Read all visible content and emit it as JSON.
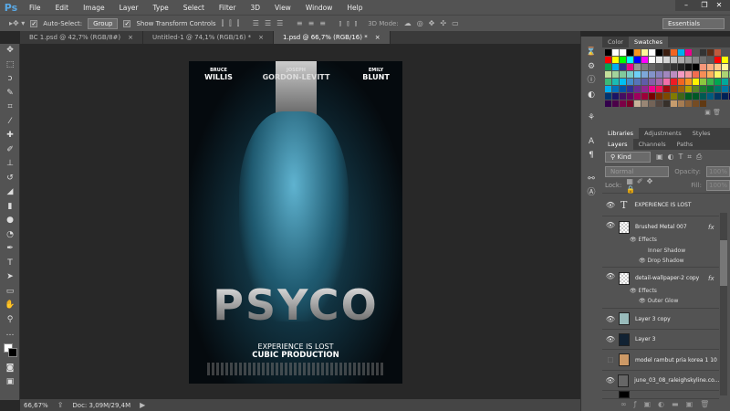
{
  "app": {
    "logo": "Ps"
  },
  "menu": [
    "File",
    "Edit",
    "Image",
    "Layer",
    "Type",
    "Select",
    "Filter",
    "3D",
    "View",
    "Window",
    "Help"
  ],
  "window_controls": {
    "minimize": "–",
    "restore": "❐",
    "close": "✕"
  },
  "options": {
    "auto_select_label": "Auto-Select:",
    "auto_select_value": "Group",
    "show_transform_label": "Show Transform Controls",
    "mode_3d_label": "3D Mode:",
    "workspace": "Essentials"
  },
  "doc_tabs": [
    {
      "label": "BC 1.psd @ 42,7% (RGB/8#)",
      "close": "×"
    },
    {
      "label": "Untitled-1 @ 74,1% (RGB/16) *",
      "close": "×"
    },
    {
      "label": "1.psd @ 66,7% (RGB/16) *",
      "close": "×",
      "active": true
    }
  ],
  "poster": {
    "actor1_first": "BRUCE",
    "actor1_last": "WILLIS",
    "actor2_first": "JOSEPH",
    "actor2_last": "GORDON-LEVITT",
    "actor3_first": "EMILY",
    "actor3_last": "BLUNT",
    "title": "PSYCO",
    "tagline": "EXPERIENCE IS LOST",
    "studio": "CUBIC PRODUCTION"
  },
  "status": {
    "zoom": "66,67%",
    "doc": "Doc: 3,09M/29,4M"
  },
  "color_panel": {
    "tabs": [
      "Color",
      "Swatches"
    ],
    "active": "Swatches"
  },
  "swatch_colors": [
    "#000000",
    "#ffffff",
    "#ffffff",
    "#000000",
    "#f7941d",
    "#fff799",
    "#ffffff",
    "#000000",
    "#3c1e10",
    "#f26522",
    "#00aeef",
    "#ec008c",
    "#555555",
    "#333333",
    "#5b2d17",
    "#c1593c",
    "#535353",
    "#535353",
    "#ff0000",
    "#ffff00",
    "#00ff00",
    "#00ffff",
    "#0000ff",
    "#ff00ff",
    "#ffffff",
    "#ebebeb",
    "#d6d6d6",
    "#c2c2c2",
    "#adadad",
    "#999999",
    "#858585",
    "#707070",
    "#5c5c5c",
    "#ff0000",
    "#ffff00",
    "#535353",
    "#00a651",
    "#00aeef",
    "#2e3192",
    "#ec008c",
    "#959595",
    "#7d7d7d",
    "#666666",
    "#555555",
    "#444444",
    "#333333",
    "#222222",
    "#111111",
    "#000000",
    "#f7977a",
    "#f9ad81",
    "#fdc68a",
    "#fff79a",
    "#535353",
    "#c4df9b",
    "#a3d39c",
    "#82ca9d",
    "#7accc8",
    "#6dcff6",
    "#7da7d9",
    "#8393ca",
    "#8781bd",
    "#a187be",
    "#bc8dbf",
    "#f49ac2",
    "#f6989d",
    "#f26c4f",
    "#f68e56",
    "#fbaf5d",
    "#fff568",
    "#acd373",
    "#7cc576",
    "#3bb878",
    "#1abbb4",
    "#00bff3",
    "#438ccb",
    "#5574b9",
    "#605ca8",
    "#855fa8",
    "#a763a8",
    "#f06eaa",
    "#ed1c24",
    "#f26522",
    "#f7941d",
    "#fff200",
    "#8dc73f",
    "#39b54a",
    "#00a651",
    "#00a99d",
    "#535353",
    "#00aeef",
    "#0072bc",
    "#0054a6",
    "#2e3192",
    "#662d91",
    "#92278f",
    "#ec008c",
    "#ed145b",
    "#9e0b0f",
    "#a0410d",
    "#a36209",
    "#aba000",
    "#598527",
    "#197b30",
    "#007236",
    "#00746b",
    "#0076a3",
    "#004a80",
    "#003471",
    "#1b1464",
    "#440e62",
    "#630460",
    "#9e005d",
    "#9e0039",
    "#790000",
    "#7b2e00",
    "#7d4900",
    "#827b00",
    "#406618",
    "#005e20",
    "#005826",
    "#005952",
    "#005b7f",
    "#003663",
    "#002157",
    "#0d004c",
    "#32004b",
    "#4b0049",
    "#7b0046",
    "#7a0026",
    "#c7b299",
    "#998675",
    "#736357",
    "#534741",
    "#37302a",
    "#c69c6d",
    "#a67c52",
    "#8c6239",
    "#754c24",
    "#603913",
    "#535353",
    "#535353",
    "#535353",
    "#535353"
  ],
  "libraries_tabs": [
    "Libraries",
    "Adjustments",
    "Styles"
  ],
  "layers_tabs": [
    "Layers",
    "Channels",
    "Paths"
  ],
  "layers_panel": {
    "filter": "Kind",
    "blend_mode": "Normal",
    "opacity_label": "Opacity:",
    "opacity": "100%",
    "lock_label": "Lock:",
    "fill_label": "Fill:",
    "fill": "100%"
  },
  "layers": [
    {
      "name": "EXPERIENCE IS LOST",
      "type": "text"
    },
    {
      "name": "Brushed Metal 007",
      "fx": "fx",
      "effects_label": "Effects",
      "effects": [
        "Inner Shadow",
        "Drop Shadow"
      ]
    },
    {
      "name": "detail-wallpaper-2 copy",
      "fx": "fx",
      "effects_label": "Effects",
      "effects": [
        "Outer Glow"
      ]
    },
    {
      "name": "Layer 3 copy"
    },
    {
      "name": "Layer 3"
    },
    {
      "name": "model rambut pria korea 1 10"
    },
    {
      "name": "june_03_08_raleighskyline.co..."
    }
  ]
}
